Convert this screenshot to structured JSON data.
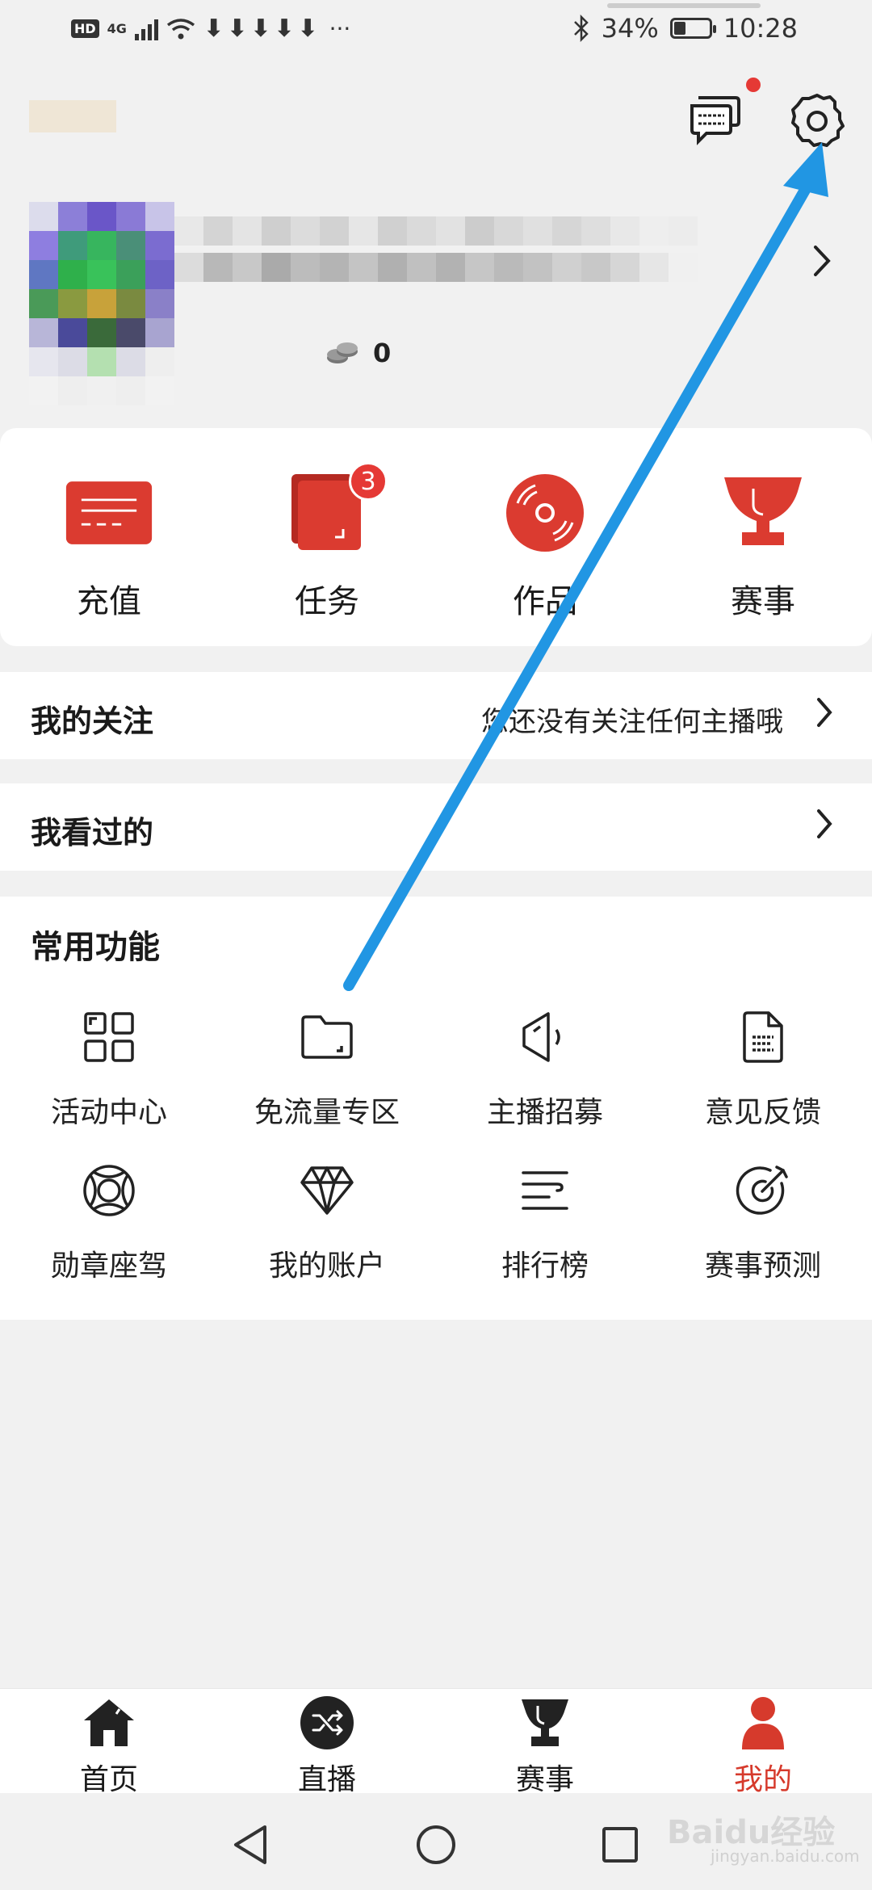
{
  "status_bar": {
    "hd": "HD",
    "network": "4G",
    "downloads": "⬇⬇⬇⬇⬇",
    "more": "···",
    "battery_text": "34%",
    "battery_level": 0.34,
    "time": "10:28"
  },
  "profile": {
    "coins": "0"
  },
  "shortcuts": [
    {
      "label": "充值",
      "icon": "recharge-card-icon"
    },
    {
      "label": "任务",
      "icon": "task-icon",
      "badge": "3"
    },
    {
      "label": "作品",
      "icon": "works-disc-icon"
    },
    {
      "label": "赛事",
      "icon": "trophy-icon"
    }
  ],
  "rows": {
    "follow_title": "我的关注",
    "follow_hint": "您还没有关注任何主播哦",
    "history_title": "我看过的"
  },
  "functions": {
    "title": "常用功能",
    "items": [
      {
        "label": "活动中心",
        "icon": "grid-icon"
      },
      {
        "label": "免流量专区",
        "icon": "folder-icon"
      },
      {
        "label": "主播招募",
        "icon": "megaphone-icon"
      },
      {
        "label": "意见反馈",
        "icon": "document-icon"
      },
      {
        "label": "勋章座驾",
        "icon": "lifebuoy-icon"
      },
      {
        "label": "我的账户",
        "icon": "diamond-icon"
      },
      {
        "label": "排行榜",
        "icon": "ranking-lines-icon"
      },
      {
        "label": "赛事预测",
        "icon": "target-icon"
      }
    ]
  },
  "nav": [
    {
      "label": "首页",
      "icon": "home-icon"
    },
    {
      "label": "直播",
      "icon": "shuffle-icon"
    },
    {
      "label": "赛事",
      "icon": "trophy-icon"
    },
    {
      "label": "我的",
      "icon": "person-icon",
      "active": true
    }
  ],
  "watermark": {
    "text": "Baidu经验",
    "sub": "jingyan.baidu.com"
  },
  "colors": {
    "accent": "#d63a2c",
    "badge": "#e53935",
    "arrow": "#2196e3",
    "background": "#f1f1f1"
  }
}
